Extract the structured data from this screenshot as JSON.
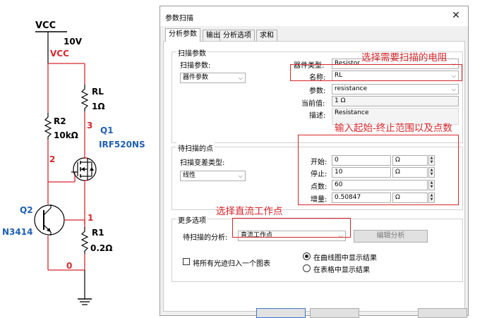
{
  "schematic": {
    "vcc_top": "VCC",
    "vcc_value": "10V",
    "vcc_net": "VCC",
    "rl_name": "RL",
    "rl_value": "1Ω",
    "node3": "3",
    "q1_name": "Q1",
    "q1_model": "IRF520NS",
    "r2_name": "R2",
    "r2_value": "10kΩ",
    "node2": "2",
    "q2_name": "Q2",
    "q2_model": "N3414",
    "node1": "1",
    "r1_name": "R1",
    "r1_value": "0.2Ω",
    "node0": "0"
  },
  "dialog": {
    "title": "参数扫描",
    "close": "✕",
    "tabs": [
      "分析参数",
      "输出",
      "分析选项",
      "求和"
    ],
    "sweep_group": {
      "title": "扫描参数",
      "sweep_param_label": "扫描参数:",
      "sweep_param_value": "器件参数",
      "device_type_label": "器件类型:",
      "device_type_value": "Resistor",
      "name_label": "名称:",
      "name_value": "RL",
      "param_label": "参数:",
      "param_value": "resistance",
      "current_label": "当前值:",
      "current_value": "1 Ω",
      "desc_label": "描述:",
      "desc_value": "Resistance"
    },
    "points_group": {
      "title": "待扫描的点",
      "var_type_label": "扫描变差类型:",
      "var_type_value": "线性",
      "start_label": "开始:",
      "start_value": "0",
      "start_unit": "Ω",
      "stop_label": "停止:",
      "stop_value": "10",
      "stop_unit": "Ω",
      "count_label": "点数:",
      "count_value": "60",
      "inc_label": "增量:",
      "inc_value": "0.50847",
      "inc_unit": "Ω"
    },
    "more_group": {
      "title": "更多选项",
      "analysis_label": "待扫描的分析:",
      "analysis_value": "直流工作点",
      "edit_button": "编辑分析",
      "group_traces": "将所有光迹归入一个图表",
      "radio_graph": "在曲线图中显示结果",
      "radio_table": "在表格中显示结果"
    }
  },
  "annotations": {
    "select_resistor": "选择需要扫描的电阻",
    "input_range": "输入起始-终止范围以及点数",
    "select_dc": "选择直流工作点"
  }
}
